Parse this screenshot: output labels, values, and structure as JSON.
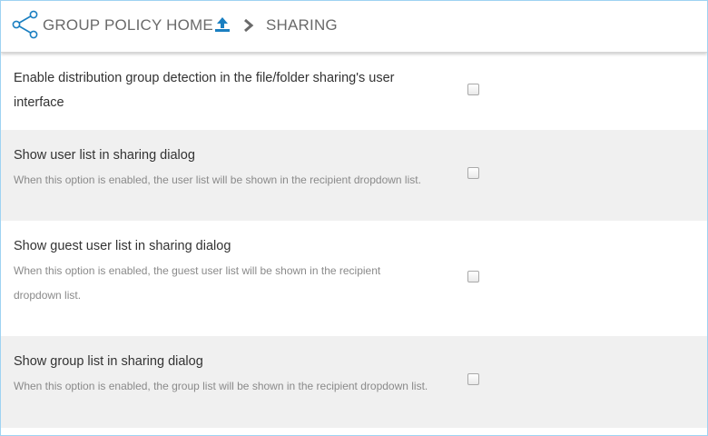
{
  "header": {
    "home_label": "GROUP POLICY HOME",
    "current_label": "SHARING",
    "icons": [
      "share-icon",
      "upload-icon",
      "chevron-right-icon"
    ]
  },
  "settings": [
    {
      "title": "Enable distribution group detection in the file/folder sharing's user interface",
      "description": "",
      "checked": false
    },
    {
      "title": "Show user list in sharing dialog",
      "description": "When this option is enabled, the user list will be shown in the recipient dropdown list.",
      "checked": false
    },
    {
      "title": "Show guest user list in sharing dialog",
      "description": "When this option is enabled, the guest user list will be shown in the recipient dropdown list.",
      "checked": false
    },
    {
      "title": "Show group list in sharing dialog",
      "description": "When this option is enabled, the group list will be shown in the recipient dropdown list.",
      "checked": false
    }
  ],
  "colors": {
    "accent": "#1a7fc1",
    "row_alt_bg": "#f0f0f0",
    "frame_border": "#9fd3f2"
  }
}
